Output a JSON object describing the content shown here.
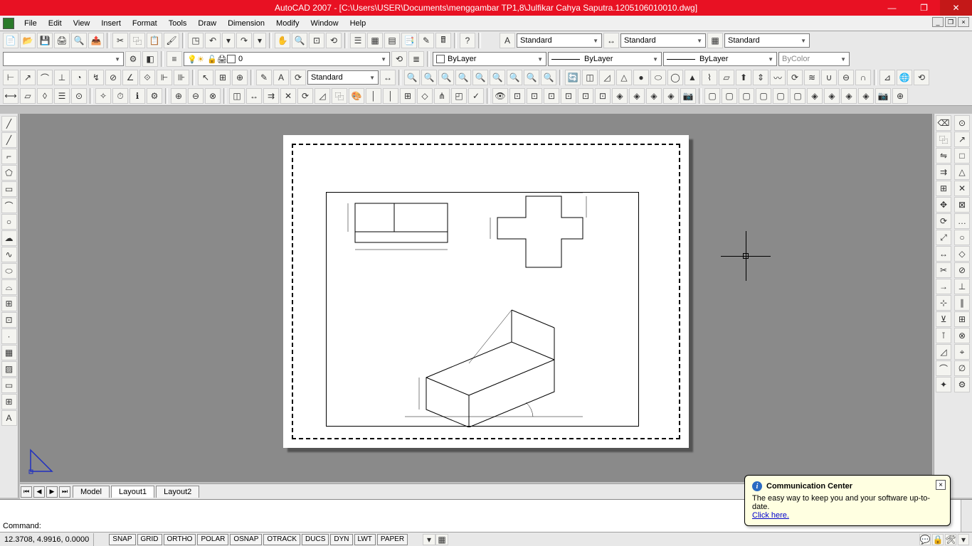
{
  "titlebar": {
    "title": "AutoCAD 2007 - [C:\\Users\\USER\\Documents\\menggambar TP1,8\\Julfikar Cahya Saputra.1205106010010.dwg]"
  },
  "menu": {
    "items": [
      "File",
      "Edit",
      "View",
      "Insert",
      "Format",
      "Tools",
      "Draw",
      "Dimension",
      "Modify",
      "Window",
      "Help"
    ]
  },
  "styles": {
    "text_style": "Standard",
    "dim_style": "Standard",
    "table_style": "Standard",
    "dim_style2": "Standard"
  },
  "layers": {
    "current": "0",
    "color_control": "ByLayer",
    "linetype_control": "ByLayer",
    "lineweight_control": "ByLayer",
    "plot_style": "ByColor"
  },
  "tabs": {
    "items": [
      "Model",
      "Layout1",
      "Layout2"
    ],
    "active": "Layout1"
  },
  "command": {
    "prompt": "Command:"
  },
  "status": {
    "coords": "12.3708, 4.9916, 0.0000",
    "toggles": [
      "SNAP",
      "GRID",
      "ORTHO",
      "POLAR",
      "OSNAP",
      "OTRACK",
      "DUCS",
      "DYN",
      "LWT",
      "PAPER"
    ]
  },
  "notification": {
    "title": "Communication Center",
    "body": "The easy way to keep you and your software up-to-date.",
    "link": "Click here."
  }
}
